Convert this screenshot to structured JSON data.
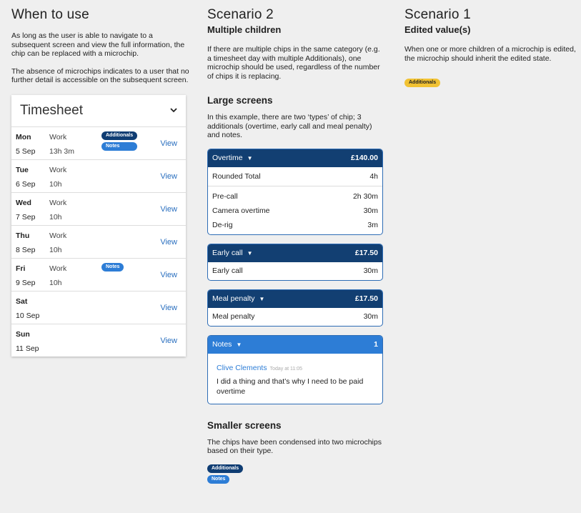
{
  "col1": {
    "title": "When to use",
    "para1": "As long as the user is able to navigate to a subsequent screen and view the full information, the chip can be replaced with a microchip.",
    "para2": "The absence of microchips indicates to a user that no further detail is accessible on the subsequent screen.",
    "timesheet": {
      "title": "Timesheet",
      "rows": [
        {
          "day": "Mon",
          "date": "5 Sep",
          "kind": "Work",
          "hours": "13h 3m",
          "chips": [
            "Additionals",
            "Notes"
          ],
          "view": "View"
        },
        {
          "day": "Tue",
          "date": "6 Sep",
          "kind": "Work",
          "hours": "10h",
          "chips": [],
          "view": "View"
        },
        {
          "day": "Wed",
          "date": "7 Sep",
          "kind": "Work",
          "hours": "10h",
          "chips": [],
          "view": "View"
        },
        {
          "day": "Thu",
          "date": "8 Sep",
          "kind": "Work",
          "hours": "10h",
          "chips": [],
          "view": "View"
        },
        {
          "day": "Fri",
          "date": "9 Sep",
          "kind": "Work",
          "hours": "10h",
          "chips": [
            "Notes"
          ],
          "view": "View"
        },
        {
          "day": "Sat",
          "date": "10 Sep",
          "kind": "",
          "hours": "",
          "chips": [],
          "view": "View"
        },
        {
          "day": "Sun",
          "date": "11 Sep",
          "kind": "",
          "hours": "",
          "chips": [],
          "view": "View"
        }
      ]
    }
  },
  "col2": {
    "title": "Scenario 2",
    "subtitle": "Multiple children",
    "para": "If there are multiple chips in the same category (e.g. a timesheet day with multiple Additionals), one microchip should be used, regardless of the number of chips it is replacing.",
    "large_heading": "Large screens",
    "large_para": "In this example, there are two ‘types’ of chip; 3 additionals (overtime, early call and meal penalty) and notes.",
    "overtime": {
      "label": "Overtime",
      "amount": "£140.00",
      "rounded_label": "Rounded Total",
      "rounded_value": "4h",
      "lines": [
        {
          "label": "Pre-call",
          "value": "2h 30m"
        },
        {
          "label": "Camera overtime",
          "value": "30m"
        },
        {
          "label": "De-rig",
          "value": "3m"
        }
      ]
    },
    "early_call": {
      "label": "Early call",
      "amount": "£17.50",
      "line_label": "Early call",
      "line_value": "30m"
    },
    "meal_penalty": {
      "label": "Meal penalty",
      "amount": "£17.50",
      "line_label": "Meal penalty",
      "line_value": "30m"
    },
    "notes": {
      "label": "Notes",
      "count": "1",
      "author": "Clive Clements",
      "time": "Today at 11:05",
      "text": "I did a thing and that’s why I need to be paid overtime"
    },
    "small_heading": "Smaller screens",
    "small_para": "The chips have been condensed into two microchips based on their type.",
    "chip_additionals": "Additionals",
    "chip_notes": "Notes"
  },
  "col3": {
    "title": "Scenario 1",
    "subtitle": "Edited value(s)",
    "para": "When one or more children of a microchip is edited, the microchip should inherit the edited state.",
    "chip": "Additionals"
  },
  "colors": {
    "navy": "#123f72",
    "blue": "#2d7dd6",
    "gold": "#f1c233",
    "link": "#2a6fbf"
  }
}
